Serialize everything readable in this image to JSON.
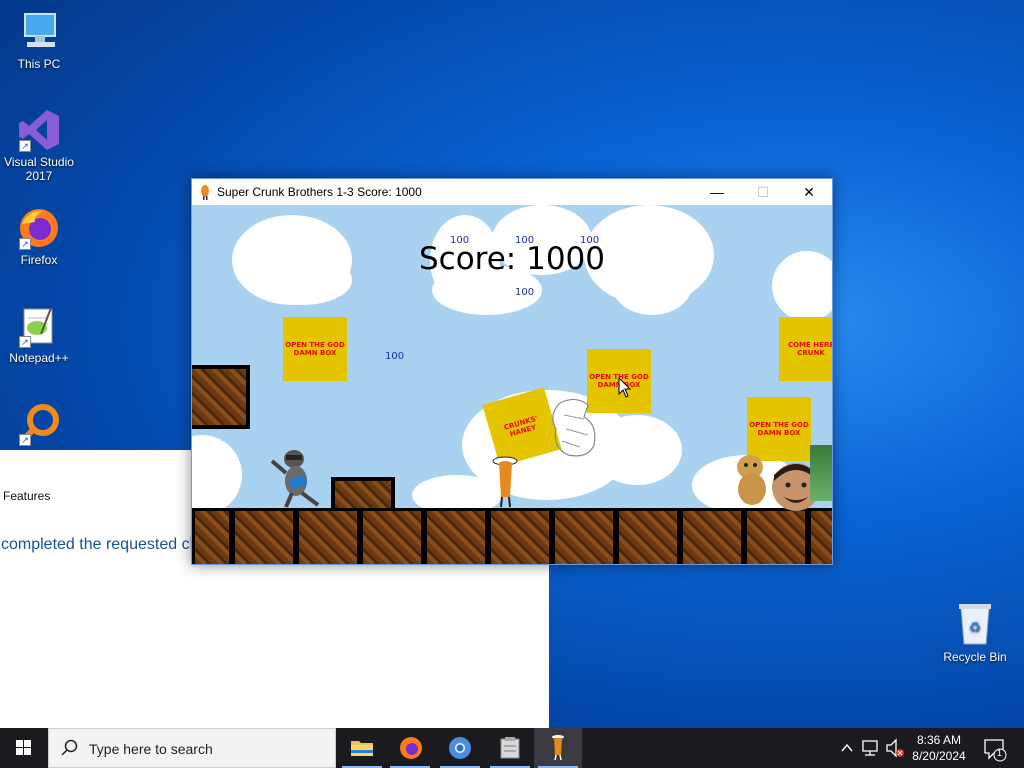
{
  "desktop": {
    "icons": [
      {
        "label": "This PC",
        "icon": "this-pc-icon"
      },
      {
        "label": "Visual Studio 2017",
        "icon": "visual-studio-icon"
      },
      {
        "label": "Firefox",
        "icon": "firefox-icon"
      },
      {
        "label": "Notepad++",
        "icon": "notepadpp-icon"
      },
      {
        "label": "",
        "icon": "magnifier-app-icon"
      }
    ],
    "recycle_bin": {
      "label": "Recycle Bin",
      "icon": "recycle-bin-icon"
    }
  },
  "background_window": {
    "features_label": "Features",
    "message": "completed the requested ch"
  },
  "game_window": {
    "title": "Super Crunk Brothers 1-3 Score: 1000",
    "controls": {
      "minimize": "—",
      "maximize": "☐",
      "close": "✕"
    },
    "score_text": "Score: 1000",
    "point_popups": [
      "100",
      "100",
      "100",
      "100",
      "100"
    ],
    "boxes": [
      {
        "text": "OPEN THE GOD DAMN BOX"
      },
      {
        "text": "OPEN THE GOD DAMN BOX"
      },
      {
        "text": "COME HERE CRUNK"
      },
      {
        "text": "OPEN THE GOD DAMN BOX"
      },
      {
        "text": "CRUNKS' HANEY"
      }
    ]
  },
  "taskbar": {
    "search_placeholder": "Type here to search",
    "apps": [
      "file-explorer-icon",
      "firefox-icon",
      "chrome-icon",
      "archive-app-icon",
      "crunk-game-icon"
    ],
    "clock_time": "8:36 AM",
    "clock_date": "8/20/2024",
    "notification_count": "1"
  },
  "colors": {
    "sky": "#a9d2f0",
    "box_yellow": "#e5c400",
    "box_text_red": "#e01010",
    "accent": "#0a64d6"
  }
}
